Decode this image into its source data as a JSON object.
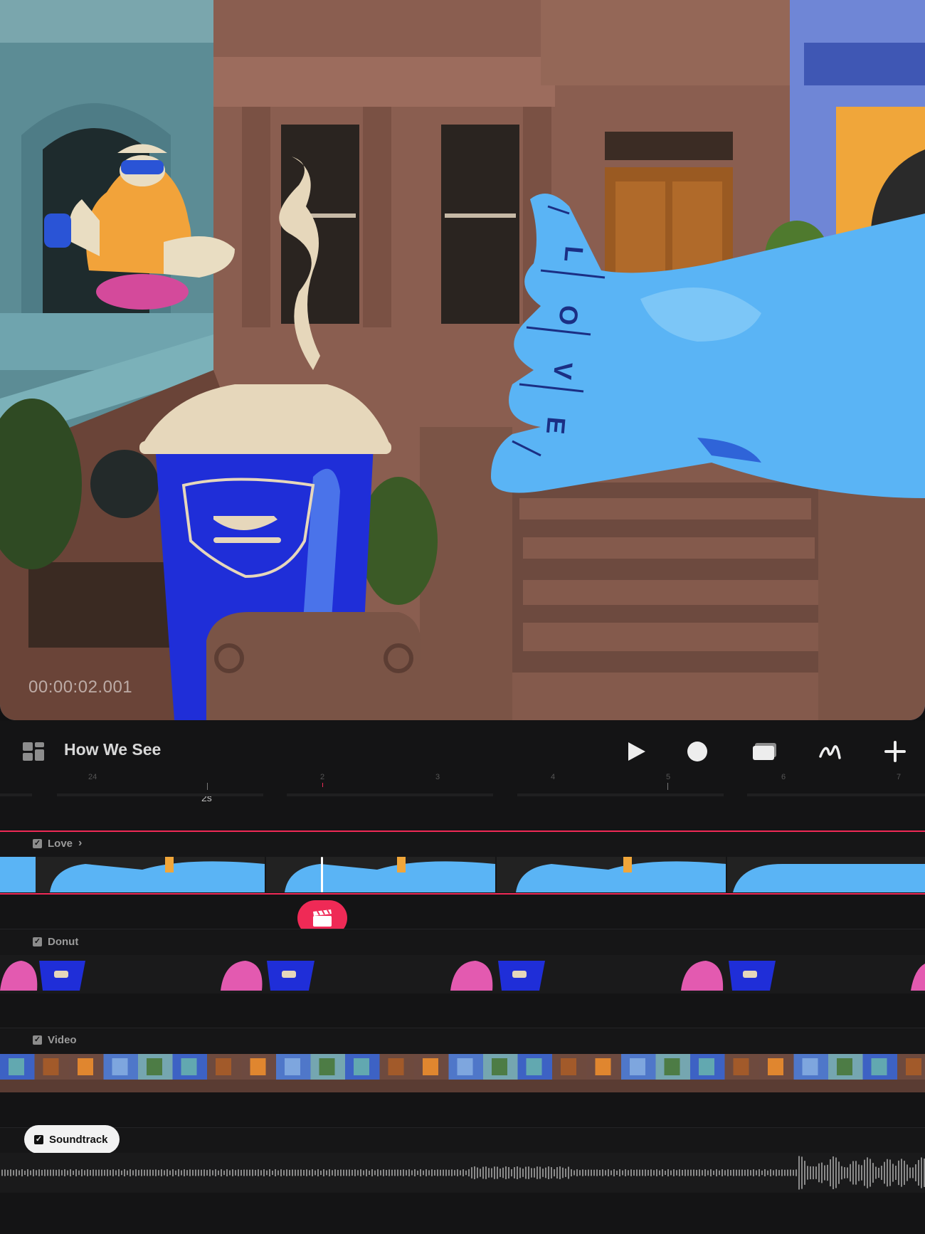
{
  "preview": {
    "timecode": "00:00:02.001",
    "tattoo_letters": "LOVE"
  },
  "toolbar": {
    "project_title": "How We See",
    "icons": [
      "layout-icon",
      "play-icon",
      "record-icon",
      "layers-icon",
      "draw-icon",
      "plus-icon"
    ]
  },
  "ruler": {
    "marker_label": "2s",
    "ticks": [
      "24",
      "2",
      "3",
      "4",
      "5",
      "6",
      "7"
    ]
  },
  "tracks": [
    {
      "name": "Love",
      "checked": true
    },
    {
      "name": "Donut",
      "checked": true
    },
    {
      "name": "Video",
      "checked": true
    },
    {
      "name": "Soundtrack",
      "checked": true
    }
  ],
  "colors": {
    "accent": "#ef2a56",
    "background": "#141415",
    "hand_blue": "#5ab4f5",
    "cup_blue": "#1f2ed8"
  }
}
